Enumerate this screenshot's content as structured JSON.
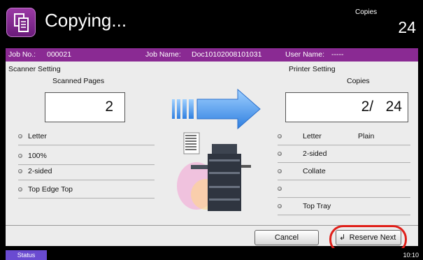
{
  "header": {
    "title": "Copying...",
    "copies_caption": "Copies",
    "copies_total": "24"
  },
  "job": {
    "job_no_label": "Job No.:",
    "job_no": "000021",
    "job_name_label": "Job Name:",
    "job_name": "Doc10102008101031",
    "user_name_label": "User Name:",
    "user_name": "-----"
  },
  "scanner": {
    "section_label": "Scanner Setting",
    "count_label": "Scanned Pages",
    "count": "2",
    "settings": [
      "Letter",
      "100%",
      "2-sided",
      "Top Edge Top"
    ]
  },
  "printer": {
    "section_label": "Printer Setting",
    "count_label": "Copies",
    "count": "2/   24",
    "settings": [
      {
        "label": "Letter",
        "extra": "Plain"
      },
      {
        "label": "2-sided",
        "extra": ""
      },
      {
        "label": "Collate",
        "extra": ""
      },
      {
        "label": "",
        "extra": ""
      },
      {
        "label": "Top Tray",
        "extra": ""
      }
    ]
  },
  "buttons": {
    "cancel": "Cancel",
    "reserve_next": "Reserve Next"
  },
  "statusbar": {
    "status": "Status",
    "time": "10:10"
  },
  "colors": {
    "accent": "#8a2a93",
    "status_button": "#6a4bd1",
    "highlight_ring": "#e0201a"
  }
}
